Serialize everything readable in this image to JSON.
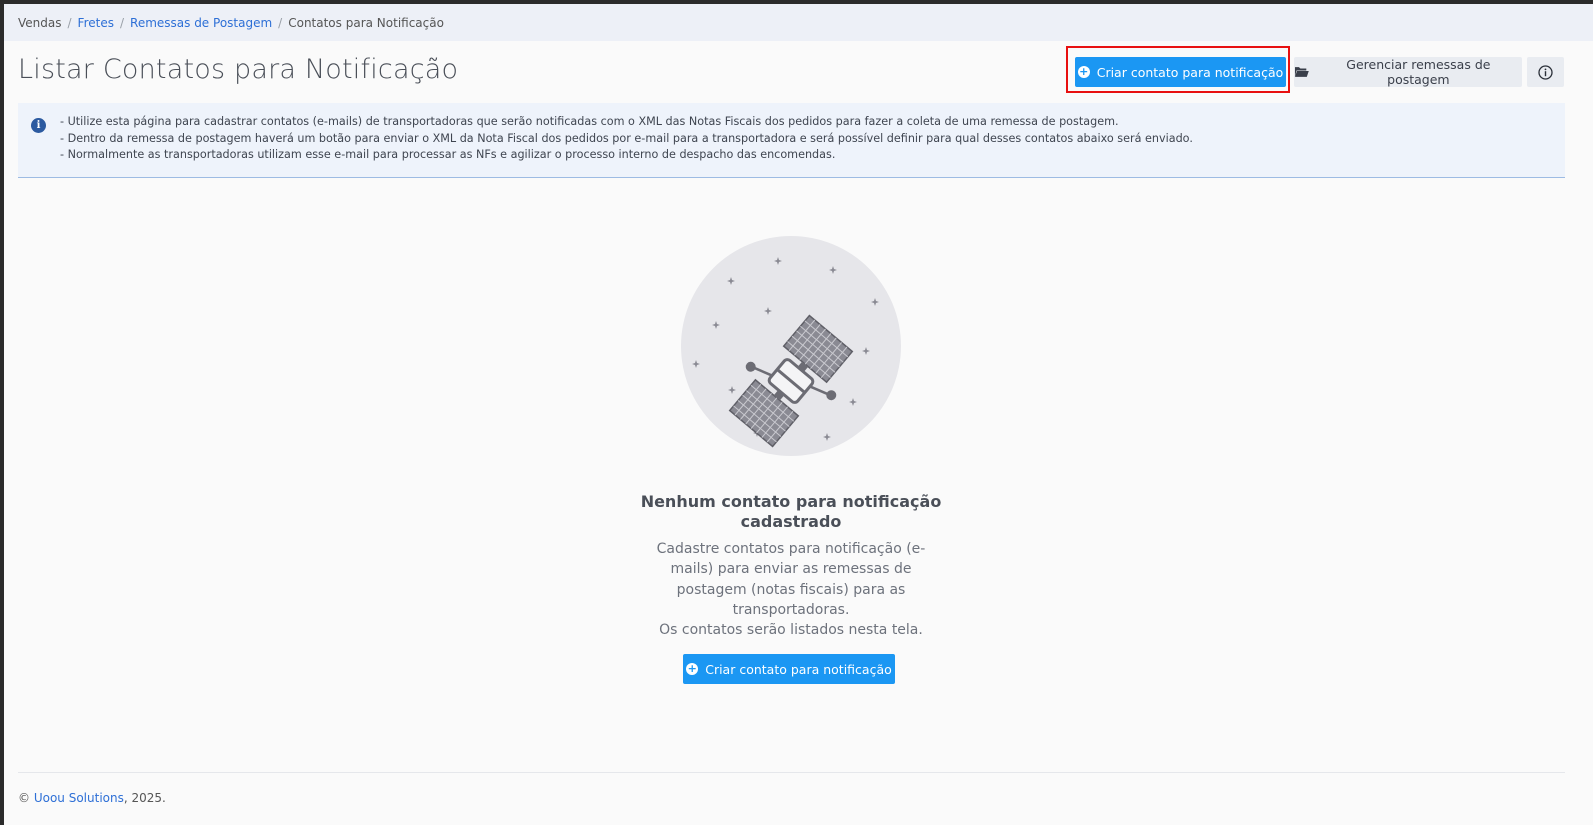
{
  "breadcrumb": {
    "items": [
      {
        "label": "Vendas",
        "link": false
      },
      {
        "label": "Fretes",
        "link": true
      },
      {
        "label": "Remessas de Postagem",
        "link": true
      },
      {
        "label": "Contatos para Notificação",
        "link": false
      }
    ],
    "separator": "/"
  },
  "header": {
    "title": "Listar Contatos para Notificação",
    "create_label": "Criar contato para notificação",
    "manage_label": "Gerenciar remessas de postagem"
  },
  "info": {
    "lines": [
      "- Utilize esta página para cadastrar contatos (e-mails) de transportadoras que serão notificadas com o XML das Notas Fiscais dos pedidos para fazer a coleta de uma remessa de postagem.",
      "- Dentro da remessa de postagem haverá um botão para enviar o XML da Nota Fiscal dos pedidos por e-mail para a transportadora e será possível definir para qual desses contatos abaixo será enviado.",
      "- Normalmente as transportadoras utilizam esse e-mail para processar as NFs e agilizar o processo interno de despacho das encomendas."
    ]
  },
  "empty_state": {
    "title": "Nenhum contato para notificação cadastrado",
    "description": "Cadastre contatos para notificação (e-mails) para enviar as remessas de postagem (notas fiscais) para as transportadoras.",
    "description2": "Os contatos serão listados nesta tela.",
    "create_label": "Criar contato para notificação",
    "illustration_icon": "satellite-icon"
  },
  "footer": {
    "copyright": "©",
    "brand": "Uoou Solutions",
    "year": ", 2025."
  },
  "colors": {
    "primary": "#1b97f3",
    "highlight": "#e81010",
    "link": "#2d6fd6",
    "info_bg": "#eef3fb"
  }
}
